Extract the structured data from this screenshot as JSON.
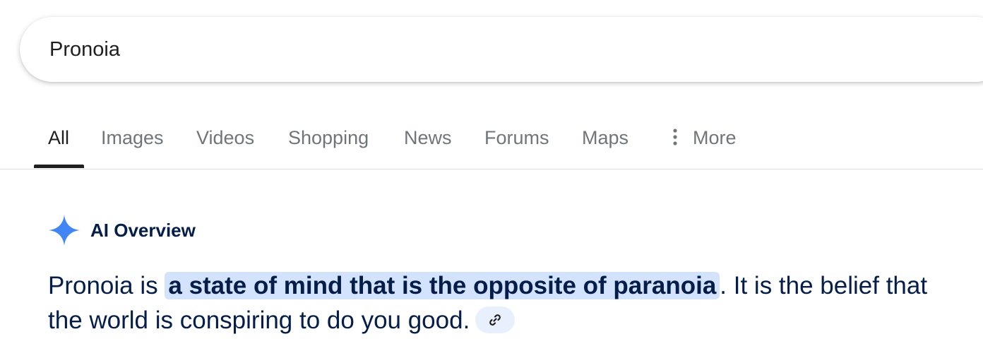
{
  "search": {
    "query": "Pronoia"
  },
  "tabs": [
    {
      "label": "All",
      "active": true
    },
    {
      "label": "Images"
    },
    {
      "label": "Videos"
    },
    {
      "label": "Shopping"
    },
    {
      "label": "News"
    },
    {
      "label": "Forums"
    },
    {
      "label": "Maps"
    },
    {
      "label": "More",
      "icon": "more-vert-icon"
    }
  ],
  "ai_overview": {
    "title": "AI Overview",
    "icon": "sparkle-icon",
    "answer": {
      "prefix": "Pronoia is ",
      "highlight": "a state of mind that is the opposite of paranoia",
      "suffix": ". It is the belief that the world is conspiring to do you good."
    },
    "source_icon": "link-icon"
  },
  "colors": {
    "accent_blue": "#4285f4",
    "highlight_bg": "#d3e3fd",
    "text_dark": "#041e49",
    "tab_inactive": "#70757a"
  }
}
